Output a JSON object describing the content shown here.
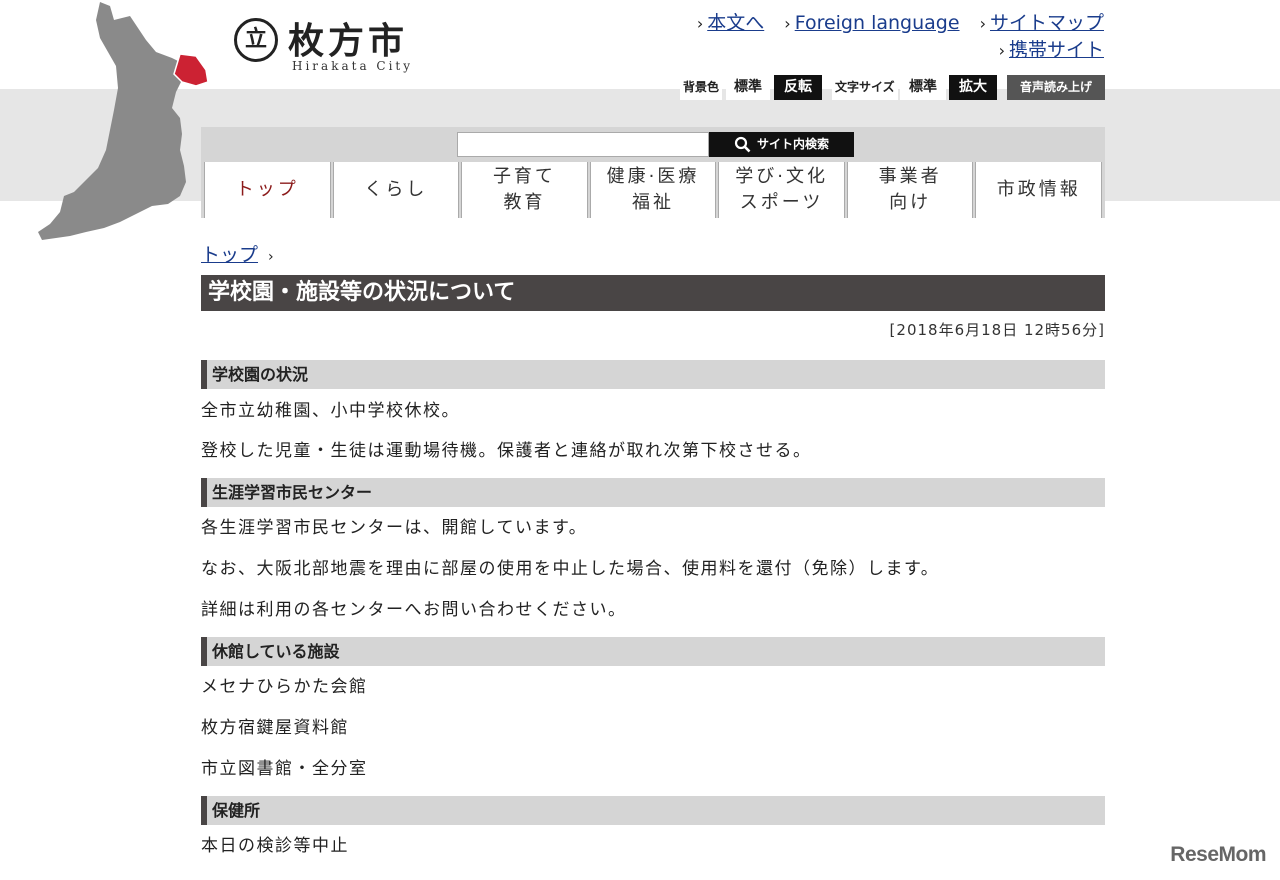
{
  "logo": {
    "mark": "立",
    "name_ja": "枚方市",
    "name_en": "Hirakata City"
  },
  "toplinks": [
    {
      "label": "本文へ"
    },
    {
      "label": "Foreign language"
    },
    {
      "label": "サイトマップ"
    },
    {
      "label": "携帯サイト"
    }
  ],
  "tools": {
    "bg_label": "背景色",
    "bg_standard": "標準",
    "bg_invert": "反転",
    "font_label": "文字サイズ",
    "font_standard": "標準",
    "font_large": "拡大",
    "voice": "音声読み上げ"
  },
  "search": {
    "value": "",
    "button_label": "サイト内検索"
  },
  "nav": [
    {
      "line1": "トップ",
      "line2": ""
    },
    {
      "line1": "くらし",
      "line2": ""
    },
    {
      "line1": "子育て",
      "line2": "教育"
    },
    {
      "line1": "健康·医療",
      "line2": "福祉"
    },
    {
      "line1": "学び·文化",
      "line2": "スポーツ"
    },
    {
      "line1": "事業者",
      "line2": "向け"
    },
    {
      "line1": "市政情報",
      "line2": ""
    }
  ],
  "breadcrumb": {
    "home": "トップ",
    "sep": "›"
  },
  "page": {
    "title": "学校園・施設等の状況について",
    "date": "[2018年6月18日 12時56分]"
  },
  "sections": [
    {
      "heading": "学校園の状況",
      "paras": [
        "全市立幼稚園、小中学校休校。",
        "登校した児童・生徒は運動場待機。保護者と連絡が取れ次第下校させる。"
      ]
    },
    {
      "heading": "生涯学習市民センター",
      "paras": [
        "各生涯学習市民センターは、開館しています。",
        "なお、大阪北部地震を理由に部屋の使用を中止した場合、使用料を還付（免除）します。",
        "詳細は利用の各センターへお問い合わせください。"
      ]
    },
    {
      "heading": "休館している施設",
      "paras": [
        "メセナひらかた会館",
        "枚方宿鍵屋資料館",
        "市立図書館・全分室"
      ]
    },
    {
      "heading": "保健所",
      "paras": [
        "本日の検診等中止"
      ]
    }
  ],
  "watermark": "ReseMom",
  "colors": {
    "map_grey": "#8a8a8a",
    "map_highlight": "#cc2233",
    "title_bar": "#494545",
    "link": "#1a3c8c"
  }
}
